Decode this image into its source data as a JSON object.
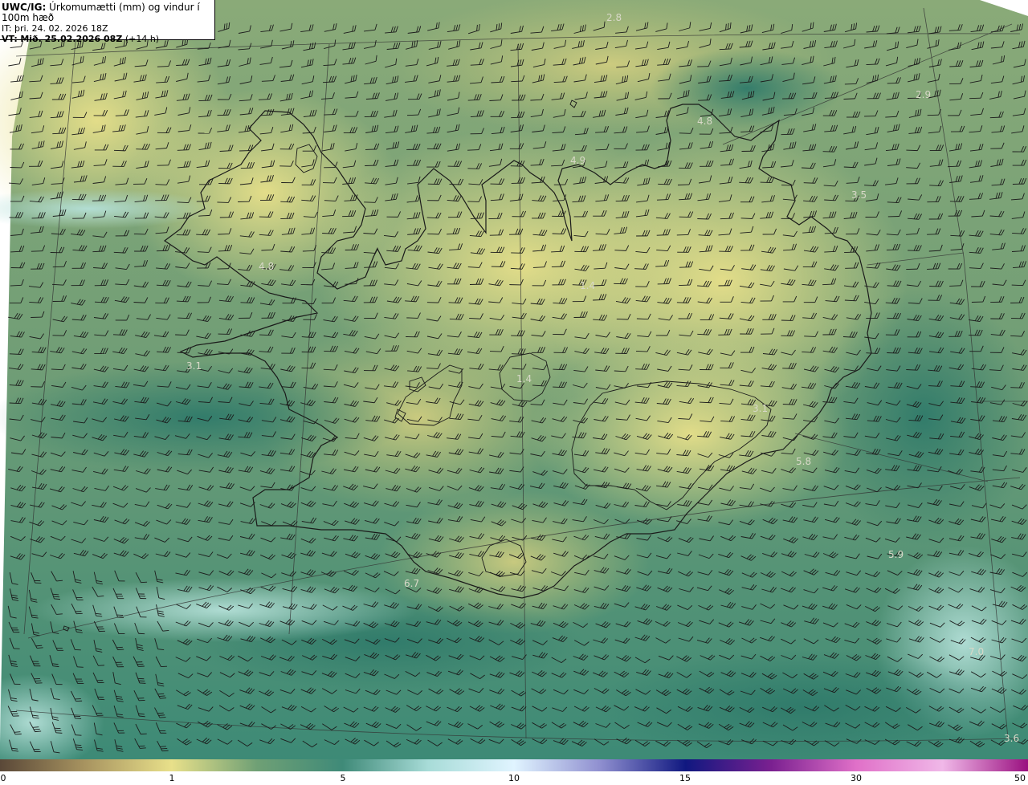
{
  "info": {
    "model": "UWC/IG:",
    "title": "Úrkomumætti (mm) og vindur í 100m hæð",
    "it": "IT: þri. 24. 02. 2026 18Z",
    "vt_prefix": "VT:",
    "vt_date": "Mið. 25.02.2026 08Z",
    "vt_lead": "(+14 h)"
  },
  "map_labels": [
    "2.8",
    "2.9",
    "4.8",
    "4.9",
    "3.5",
    "4.8",
    "1.4",
    "3.1",
    "1.4",
    "3.1",
    "5.8",
    "5.9",
    "6.7",
    "7.0",
    "3.6"
  ],
  "colorbar": {
    "ticks": [
      "0",
      "1",
      "5",
      "10",
      "15",
      "30",
      "50"
    ],
    "colors": [
      "#5a4838",
      "#a89460",
      "#e8e08a",
      "#6fa075",
      "#3f8a78",
      "#a8dcd8",
      "#e0f4ff",
      "#9090d0",
      "#101880",
      "#7a2090",
      "#e070c8",
      "#f0b8e8",
      "#9a1080"
    ]
  }
}
